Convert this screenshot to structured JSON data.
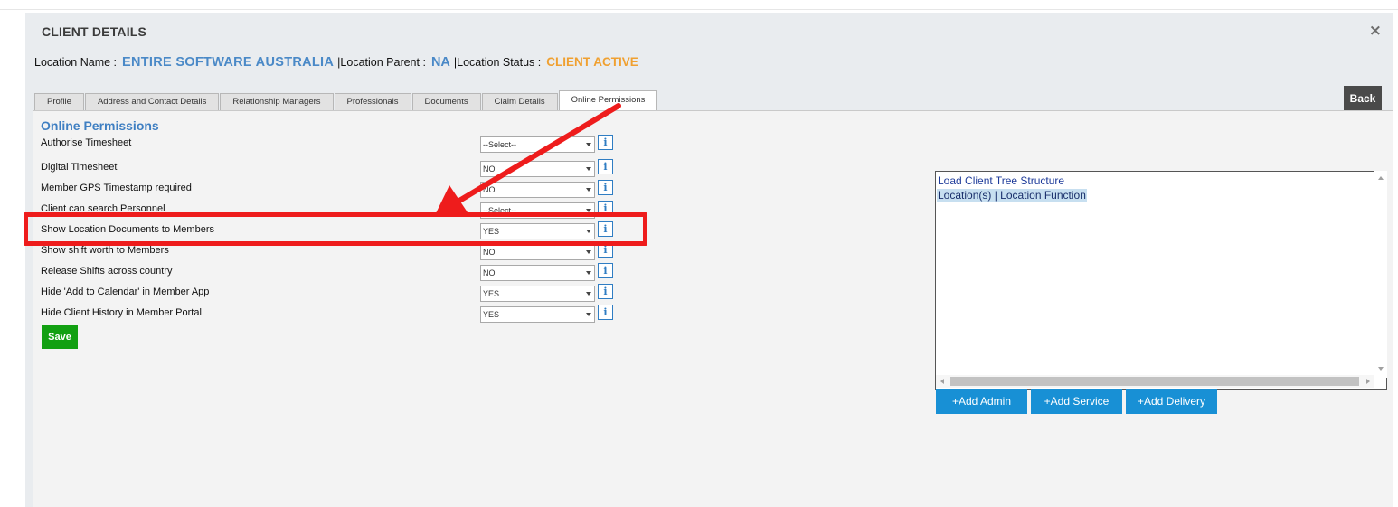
{
  "dialog": {
    "title": "CLIENT DETAILS",
    "close_label": "×"
  },
  "location": {
    "name_label": "Location Name :",
    "name_value": "ENTIRE SOFTWARE AUSTRALIA",
    "parent_label": "|Location Parent :",
    "parent_value": "NA",
    "status_label": "|Location Status :",
    "status_value": "CLIENT ACTIVE"
  },
  "tabs": [
    {
      "label": "Profile"
    },
    {
      "label": "Address and Contact Details"
    },
    {
      "label": "Relationship Managers"
    },
    {
      "label": "Professionals"
    },
    {
      "label": "Documents"
    },
    {
      "label": "Claim Details"
    },
    {
      "label": "Online Permissions",
      "active": true
    }
  ],
  "back_label": "Back",
  "permissions": {
    "title": "Online Permissions",
    "rows": [
      {
        "label": "Authorise Timesheet",
        "value": "--Select--"
      },
      {
        "label": "Digital Timesheet",
        "value": "NO"
      },
      {
        "label": "Member GPS Timestamp required",
        "value": "NO"
      },
      {
        "label": "Client can search Personnel",
        "value": "--Select--"
      },
      {
        "label": "Show Location Documents to Members",
        "value": "YES"
      },
      {
        "label": "Show shift worth to Members",
        "value": "NO"
      },
      {
        "label": "Release Shifts across country",
        "value": "NO"
      },
      {
        "label": "Hide 'Add to Calendar' in Member App",
        "value": "YES"
      },
      {
        "label": "Hide Client History in Member Portal",
        "value": "YES"
      }
    ],
    "info_label": "i",
    "save_label": "Save"
  },
  "tree": {
    "load_link": "Load Client Tree Structure",
    "node_label": "Location(s) | Location Function"
  },
  "add_buttons": [
    "+Add Admin",
    "+Add Service",
    "+Add Delivery"
  ],
  "annotation_color": "#ee1c1c",
  "accent_colors": {
    "link_blue": "#4a89c7",
    "status_orange": "#f0a030",
    "save_green": "#12a012",
    "add_blue": "#1890d5"
  }
}
